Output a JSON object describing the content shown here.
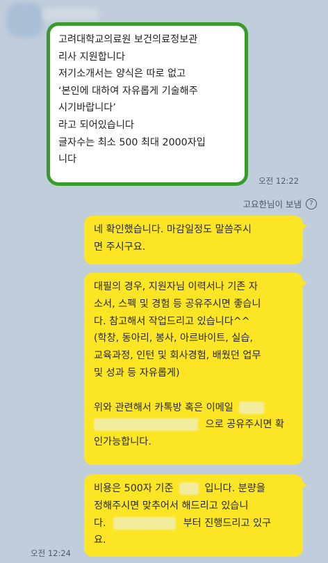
{
  "incoming": {
    "lines": [
      "고려대학교의료원 보건의료정보관",
      "리사 지원합니다",
      "저기소개서는 양식은 따로 없고",
      "‘본인에 대하여 자유롭게 기술해주",
      "시기바랍니다’",
      "라고 되어있습니다",
      "글자수는 최소 500 최대 2000자입",
      "니다"
    ],
    "time": "오전 12:22"
  },
  "sent_note": "고요한님이 보냄",
  "sent_icon": "help-circle-icon",
  "outgoing": [
    {
      "lines": [
        "네 확인했습니다. 마감일정도 말씀주시",
        "면 주시구요."
      ]
    },
    {
      "lines": [
        "대필의 경우, 지원자님 이력서나 기존 자",
        "소서, 스펙 및 경험 등 공유주시면 좋습니",
        "다. 참고해서 작업드리고 있습니다^^",
        "(학창, 동아리, 봉사, 아르바이트, 실습,",
        "교육과정, 인턴 및 회사경험, 배웠던 업무",
        "및 성과 등 자유롭게)",
        "",
        "위와 관련해서 카톡방 혹은 이메일",
        "으로 공유주시면 확",
        "인가능합니다."
      ]
    },
    {
      "lines": [
        "비용은 500자 기준",
        "입니다. 분량을",
        "정해주시면 맞추어서 해드리고 있습니",
        "다.",
        "부터 진행드리고 있구",
        "요."
      ]
    }
  ],
  "outgoing_time": "오전 12:24",
  "colors": {
    "background": "#c0cddb",
    "out_bubble": "#fbe524",
    "highlight": "#3a9a2c"
  }
}
